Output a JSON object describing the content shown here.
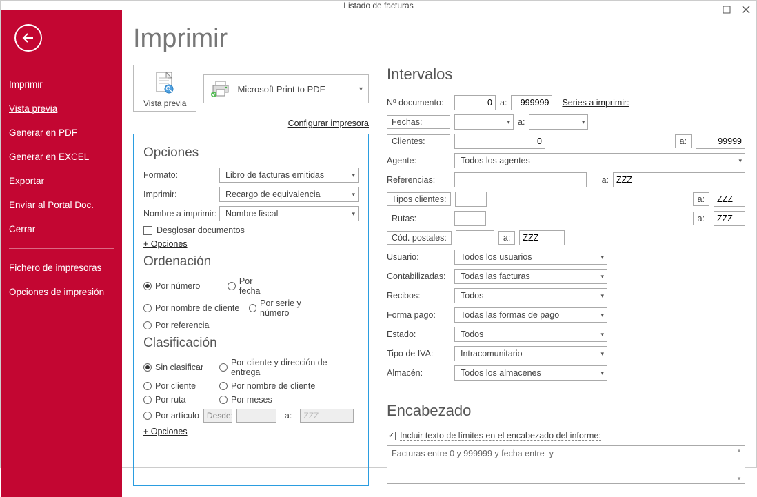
{
  "window": {
    "title": "Listado de facturas"
  },
  "sidebar": {
    "items": [
      "Imprimir",
      "Vista previa",
      "Generar en PDF",
      "Generar en EXCEL",
      "Exportar",
      "Enviar al Portal Doc.",
      "Cerrar"
    ],
    "items2": [
      "Fichero de impresoras",
      "Opciones de impresión"
    ]
  },
  "page": {
    "title": "Imprimir",
    "preview_label": "Vista previa",
    "printer_name": "Microsoft Print to PDF",
    "configure_printer": "Configurar impresora"
  },
  "opciones": {
    "title": "Opciones",
    "formato_label": "Formato:",
    "formato_value": "Libro de facturas emitidas",
    "imprimir_label": "Imprimir:",
    "imprimir_value": "Recargo de equivalencia",
    "nombre_label": "Nombre a imprimir:",
    "nombre_value": "Nombre fiscal",
    "desglosar_label": "Desglosar documentos",
    "mas_opciones": "+ Opciones"
  },
  "ordenacion": {
    "title": "Ordenación",
    "r1": "Por número",
    "r2": "Por fecha",
    "r3": "Por nombre de cliente",
    "r4": "Por serie y número",
    "r5": "Por referencia"
  },
  "clasificacion": {
    "title": "Clasificación",
    "c1": "Sin clasificar",
    "c2": "Por cliente y dirección de entrega",
    "c3": "Por cliente",
    "c4": "Por nombre de cliente",
    "c5": "Por ruta",
    "c6": "Por meses",
    "c7": "Por artículo",
    "desde": "Desde:",
    "a": "a:",
    "a_val": "ZZZ",
    "mas_opciones": "+ Opciones"
  },
  "intervalos": {
    "title": "Intervalos",
    "ndoc_label": "Nº documento:",
    "ndoc_from": "0",
    "ndoc_to": "999999",
    "a": "a:",
    "series_link": "Series a imprimir:",
    "fechas_label": "Fechas:",
    "clientes_label": "Clientes:",
    "clientes_from": "0",
    "clientes_to": "99999",
    "agente_label": "Agente:",
    "agente_value": "Todos los agentes",
    "referencias_label": "Referencias:",
    "ref_to": "ZZZ",
    "tipos_label": "Tipos clientes:",
    "tipos_to": "ZZZ",
    "rutas_label": "Rutas:",
    "rutas_to": "ZZZ",
    "cp_label": "Cód. postales:",
    "cp_to": "ZZZ",
    "usuario_label": "Usuario:",
    "usuario_value": "Todos los usuarios",
    "cont_label": "Contabilizadas:",
    "cont_value": "Todas las facturas",
    "recibos_label": "Recibos:",
    "recibos_value": "Todos",
    "fpago_label": "Forma pago:",
    "fpago_value": "Todas las formas de pago",
    "estado_label": "Estado:",
    "estado_value": "Todos",
    "iva_label": "Tipo de IVA:",
    "iva_value": "Intracomunitario",
    "almacen_label": "Almacén:",
    "almacen_value": "Todos los almacenes"
  },
  "encabezado": {
    "title": "Encabezado",
    "check_label": "Incluir texto de límites en el encabezado del informe:",
    "text": "Facturas entre 0 y 999999 y fecha entre  y"
  }
}
